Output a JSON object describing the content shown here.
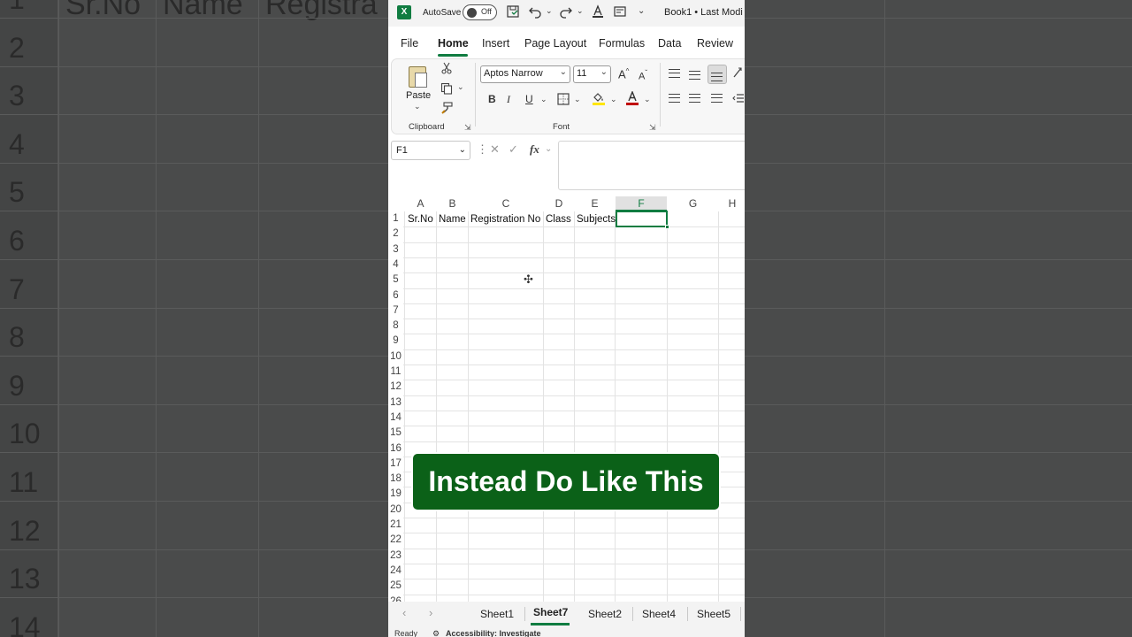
{
  "background": {
    "header_text": [
      "Sr.No",
      "Name",
      "Registra"
    ],
    "row_numbers": [
      "1",
      "2",
      "3",
      "4",
      "5",
      "6",
      "7",
      "8",
      "9",
      "10",
      "11",
      "12",
      "13",
      "14"
    ]
  },
  "titlebar": {
    "autosave_label": "AutoSave",
    "autosave_state": "Off",
    "doc_title": "Book1 • Last Modi"
  },
  "menu": {
    "tabs": [
      "File",
      "Home",
      "Insert",
      "Page Layout",
      "Formulas",
      "Data",
      "Review"
    ]
  },
  "ribbon": {
    "paste_label": "Paste",
    "clipboard_label": "Clipboard",
    "font_name": "Aptos Narrow",
    "font_size": "11",
    "font_label": "Font",
    "bold": "B",
    "italic": "I",
    "underline": "U",
    "grow_font": "A",
    "shrink_font": "A",
    "font_color_glyph": "A"
  },
  "formula_bar": {
    "name_box": "F1",
    "fx": "fx",
    "value": ""
  },
  "grid": {
    "columns": [
      "A",
      "B",
      "C",
      "D",
      "E",
      "F",
      "G",
      "H"
    ],
    "selected_column": "F",
    "rows": [
      "1",
      "2",
      "3",
      "4",
      "5",
      "6",
      "7",
      "8",
      "9",
      "10",
      "11",
      "12",
      "13",
      "14",
      "15",
      "16",
      "17",
      "18",
      "19",
      "20",
      "21",
      "22",
      "23",
      "24",
      "25",
      "26"
    ],
    "row1": [
      "Sr.No",
      "Name",
      "Registration No",
      "Class",
      "Subjects"
    ]
  },
  "sheets": {
    "tabs": [
      "Sheet1",
      "Sheet7",
      "Sheet2",
      "Sheet4",
      "Sheet5"
    ],
    "active": "Sheet7"
  },
  "status": {
    "ready": "Ready",
    "accessibility": "Accessibility: Investigate"
  },
  "overlay": {
    "caption": "Instead Do Like This"
  },
  "colors": {
    "excel_green": "#107c41",
    "banner_green": "#0b6118",
    "fill_yellow": "#ffe600",
    "font_red": "#c00000"
  }
}
